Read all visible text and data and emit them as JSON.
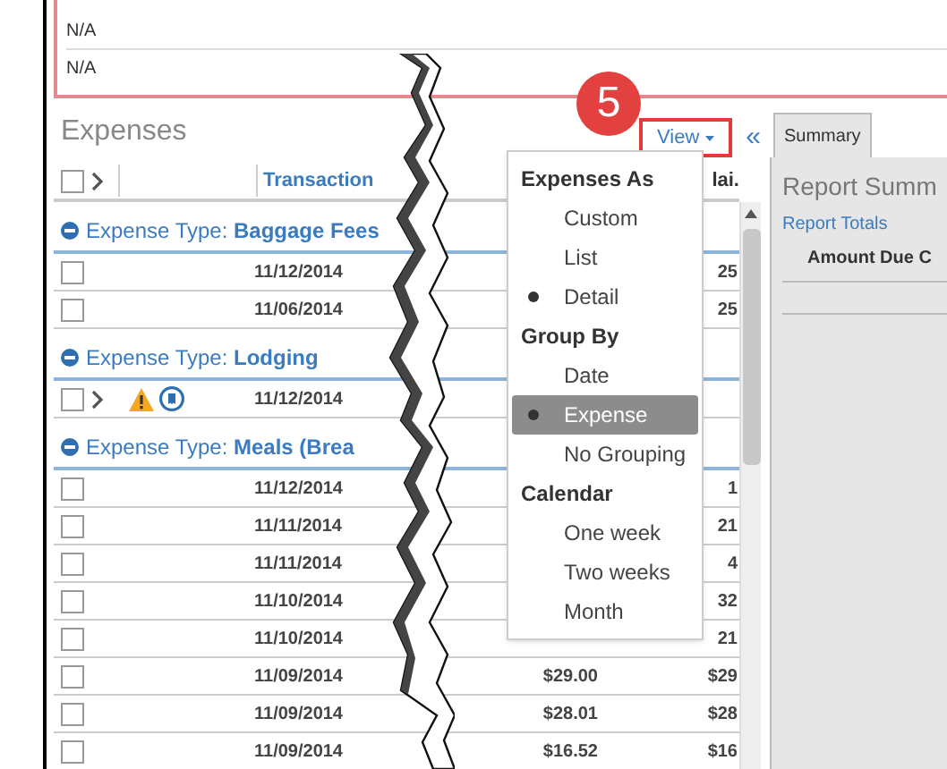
{
  "top_rows": [
    "N/A",
    "N/A"
  ],
  "expenses": {
    "title": "Expenses",
    "select_all_checked": false,
    "view_button": "View",
    "collapse": "«",
    "callout": "5",
    "columns": [
      {
        "label": "Transaction"
      },
      {
        "label": "lai."
      }
    ],
    "groups": [
      {
        "prefix": "Expense Type:",
        "name": "Baggage Fees",
        "rows": [
          {
            "kind": "plain",
            "checked": false,
            "date": "11/12/2014",
            "amount": "",
            "total": "25"
          },
          {
            "kind": "plain",
            "checked": false,
            "date": "11/06/2014",
            "amount": "",
            "total": "25"
          }
        ]
      },
      {
        "prefix": "Expense Type:",
        "name": "Lodging",
        "rows": [
          {
            "kind": "flagged",
            "checked": false,
            "date": "11/12/2014",
            "amount": "",
            "total": ""
          }
        ]
      },
      {
        "prefix": "Expense Type:",
        "name": "Meals (Brea",
        "rows": [
          {
            "kind": "plain",
            "checked": false,
            "date": "11/12/2014",
            "amount": "",
            "total": "1"
          },
          {
            "kind": "plain",
            "checked": false,
            "date": "11/11/2014",
            "amount": "",
            "total": "21"
          },
          {
            "kind": "plain",
            "checked": false,
            "date": "11/11/2014",
            "amount": "",
            "total": "4"
          },
          {
            "kind": "plain",
            "checked": false,
            "date": "11/10/2014",
            "amount": "",
            "total": "32"
          },
          {
            "kind": "plain",
            "checked": false,
            "date": "11/10/2014",
            "amount": "",
            "total": "21"
          },
          {
            "kind": "plain",
            "checked": false,
            "date": "11/09/2014",
            "amount": "$29.00",
            "total": "$29"
          },
          {
            "kind": "plain",
            "checked": false,
            "date": "11/09/2014",
            "amount": "$28.01",
            "total": "$28"
          },
          {
            "kind": "plain",
            "checked": false,
            "date": "11/09/2014",
            "amount": "$16.52",
            "total": "$16"
          }
        ]
      }
    ]
  },
  "view_menu": [
    {
      "title": "Expenses As",
      "items": [
        {
          "label": "Custom",
          "selected": false,
          "highlighted": false
        },
        {
          "label": "List",
          "selected": false,
          "highlighted": false
        },
        {
          "label": "Detail",
          "selected": true,
          "highlighted": false
        }
      ]
    },
    {
      "title": "Group By",
      "items": [
        {
          "label": "Date",
          "selected": false,
          "highlighted": false
        },
        {
          "label": "Expense",
          "selected": true,
          "highlighted": true
        },
        {
          "label": "No Grouping",
          "selected": false,
          "highlighted": false
        }
      ]
    },
    {
      "title": "Calendar",
      "items": [
        {
          "label": "One week",
          "selected": false,
          "highlighted": false
        },
        {
          "label": "Two weeks",
          "selected": false,
          "highlighted": false
        },
        {
          "label": "Month",
          "selected": false,
          "highlighted": false
        }
      ]
    }
  ],
  "summary": {
    "tabs": [
      {
        "label": "Summary",
        "selected": true
      }
    ],
    "title": "Report Summ",
    "link": "Report Totals",
    "column": "Amount Due C"
  }
}
